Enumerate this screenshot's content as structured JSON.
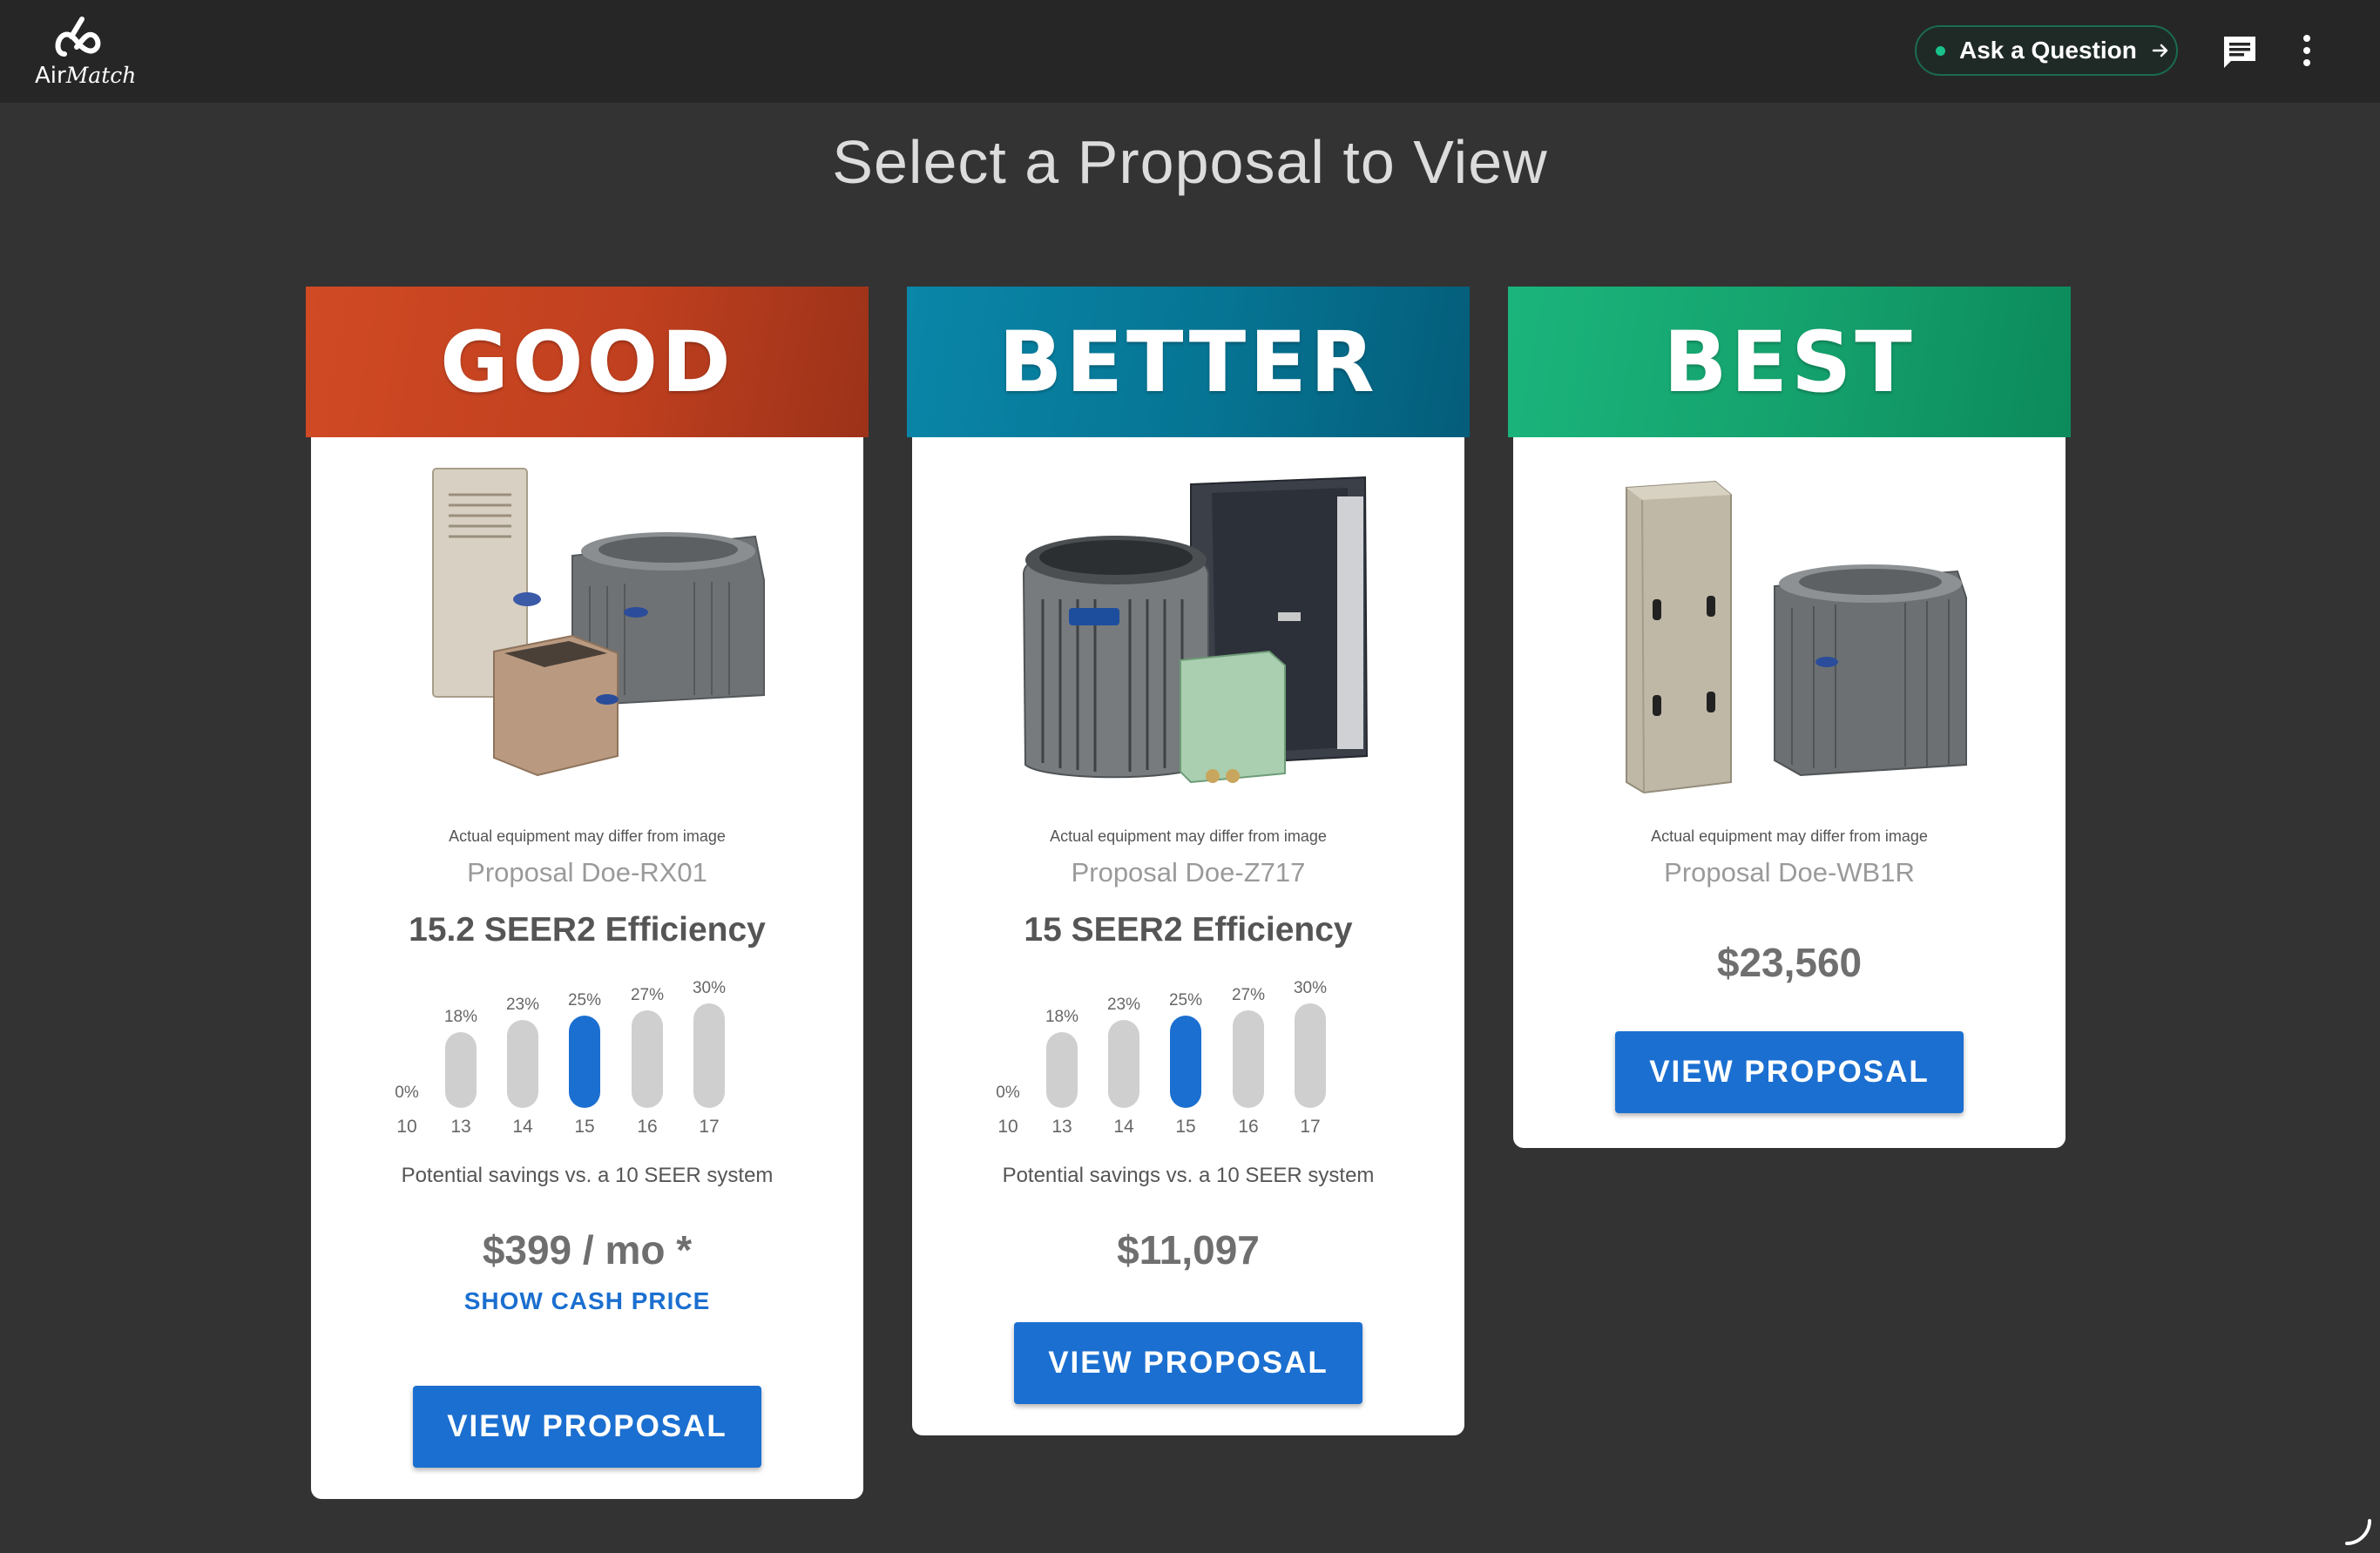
{
  "app": {
    "logo_text_main": "Air",
    "logo_text_script": "Match",
    "ask_label": "Ask a Question",
    "colors": {
      "topbar": "#262626",
      "background": "#333333",
      "accent_blue": "#1b6fd0",
      "ask_green": "#19c28a"
    }
  },
  "icons": {
    "chat": "chat-bubble-icon",
    "more": "more-vertical-icon",
    "arrow": "arrow-right-icon",
    "resize": "resize-handle-icon"
  },
  "page": {
    "title": "Select a Proposal to View"
  },
  "cards": [
    {
      "tier": "GOOD",
      "color": "#c1401f",
      "disclaimer": "Actual equipment may differ from image",
      "proposal": "Proposal Doe-RX01",
      "efficiency": "15.2 SEER2 Efficiency",
      "savings_chart": {
        "seer": [
          "10",
          "13",
          "14",
          "15",
          "16",
          "17"
        ],
        "percent": [
          "0%",
          "18%",
          "23%",
          "25%",
          "27%",
          "30%"
        ],
        "values": [
          0,
          18,
          23,
          25,
          27,
          30
        ],
        "active_index": 3
      },
      "savings_caption": "Potential savings vs. a 10 SEER system",
      "price": "$399 / mo *",
      "cash_link": "SHOW CASH PRICE",
      "button": "VIEW PROPOSAL"
    },
    {
      "tier": "BETTER",
      "color": "#067493",
      "disclaimer": "Actual equipment may differ from image",
      "proposal": "Proposal Doe-Z717",
      "efficiency": "15 SEER2 Efficiency",
      "savings_chart": {
        "seer": [
          "10",
          "13",
          "14",
          "15",
          "16",
          "17"
        ],
        "percent": [
          "0%",
          "18%",
          "23%",
          "25%",
          "27%",
          "30%"
        ],
        "values": [
          0,
          18,
          23,
          25,
          27,
          30
        ],
        "active_index": 3
      },
      "savings_caption": "Potential savings vs. a 10 SEER system",
      "price": "$11,097",
      "button": "VIEW PROPOSAL"
    },
    {
      "tier": "BEST",
      "color": "#14a06c",
      "disclaimer": "Actual equipment may differ from image",
      "proposal": "Proposal Doe-WB1R",
      "price": "$23,560",
      "button": "VIEW PROPOSAL"
    }
  ]
}
